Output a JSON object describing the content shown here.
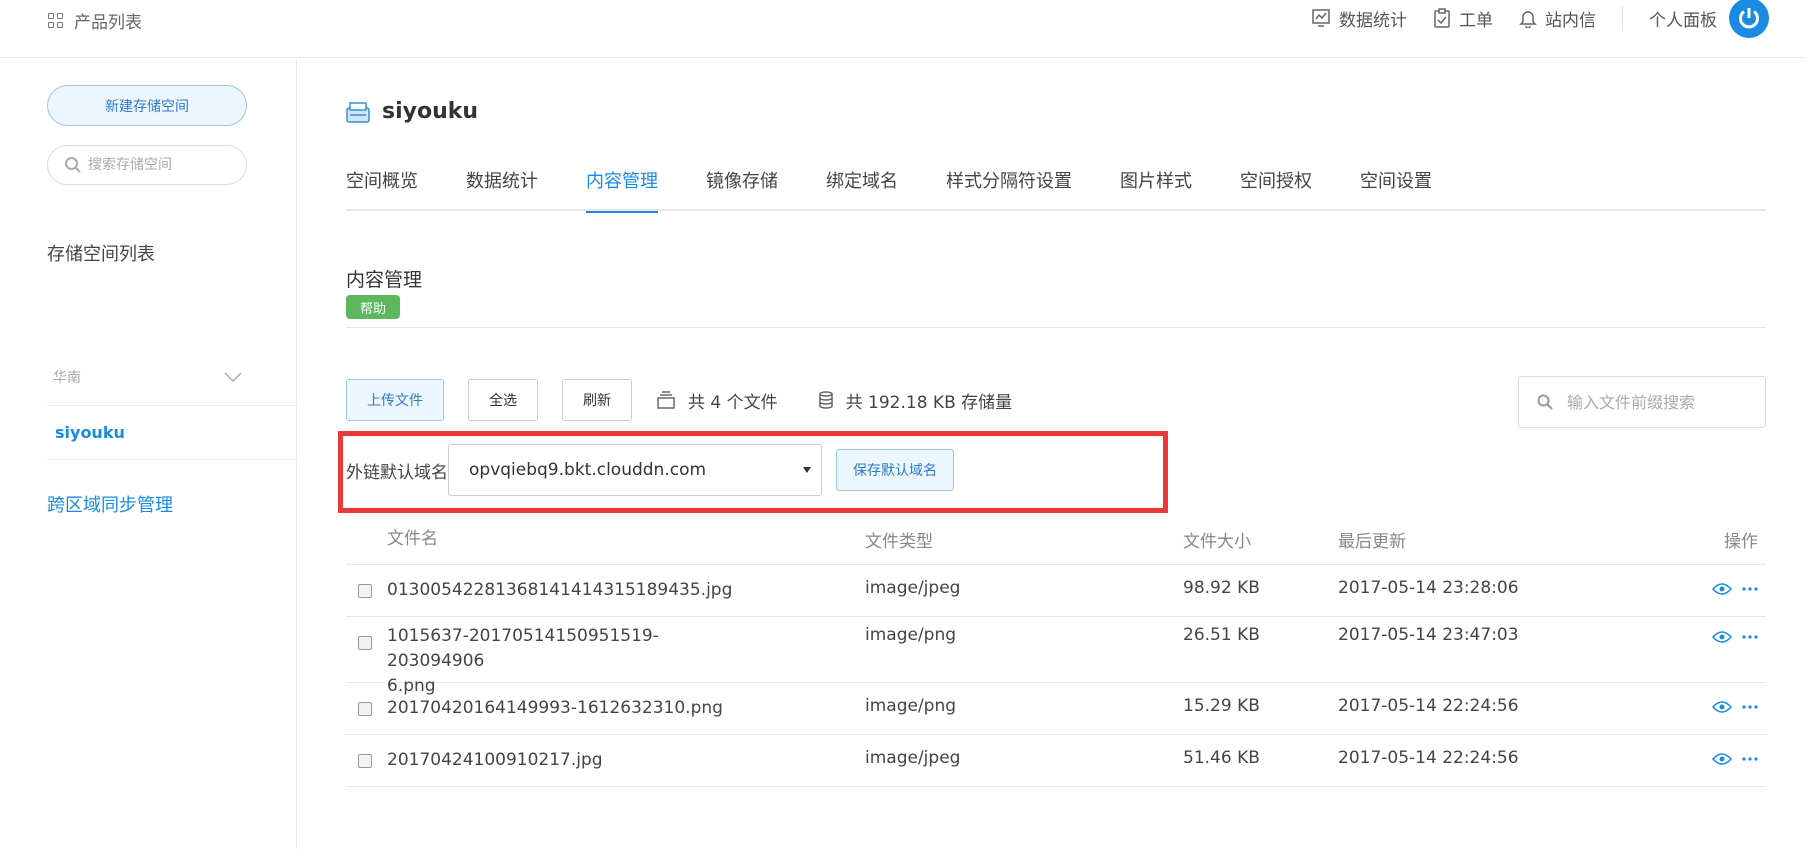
{
  "topbar": {
    "product_list": "产品列表",
    "nav": [
      {
        "label": "数据统计",
        "icon": "chart-icon"
      },
      {
        "label": "工单",
        "icon": "clipboard-icon"
      },
      {
        "label": "站内信",
        "icon": "bell-icon"
      }
    ],
    "personal_panel": "个人面板"
  },
  "sidebar": {
    "new_bucket": "新建存储空间",
    "search_placeholder": "搜索存储空间",
    "list_title": "存储空间列表",
    "region": "华南",
    "bucket": "siyouku",
    "cross_sync": "跨区域同步管理"
  },
  "main": {
    "bucket_name": "siyouku",
    "tabs": [
      "空间概览",
      "数据统计",
      "内容管理",
      "镜像存储",
      "绑定域名",
      "样式分隔符设置",
      "图片样式",
      "空间授权",
      "空间设置"
    ],
    "active_tab": 2,
    "section_title": "内容管理",
    "help": "帮助",
    "toolbar": {
      "upload": "上传文件",
      "select_all": "全选",
      "refresh": "刷新",
      "file_count": "共 4 个文件",
      "storage": "共 192.18 KB 存储量",
      "search_placeholder": "输入文件前缀搜索"
    },
    "domain": {
      "label": "外链默认域名",
      "selected": "opvqiebq9.bkt.clouddn.com",
      "save": "保存默认域名"
    },
    "table": {
      "headers": {
        "name": "文件名",
        "type": "文件类型",
        "size": "文件大小",
        "updated": "最后更新",
        "ops": "操作"
      },
      "rows": [
        {
          "name": "01300542281368141414315189435.jpg",
          "type": "image/jpeg",
          "size": "98.92 KB",
          "updated": "2017-05-14 23:28:06"
        },
        {
          "name": "1015637-20170514150951519-2030949066.png",
          "name_l1": "1015637-20170514150951519-203094906",
          "name_l2": "6.png",
          "type": "image/png",
          "size": "26.51 KB",
          "updated": "2017-05-14 23:47:03"
        },
        {
          "name": "20170420164149993-1612632310.png",
          "type": "image/png",
          "size": "15.29 KB",
          "updated": "2017-05-14 22:24:56"
        },
        {
          "name": "20170424100910217.jpg",
          "type": "image/jpeg",
          "size": "51.46 KB",
          "updated": "2017-05-14 22:24:56"
        }
      ]
    }
  },
  "colors": {
    "accent": "#1a8be0",
    "help_green": "#5cb85c",
    "highlight_red": "#e83a3a"
  }
}
